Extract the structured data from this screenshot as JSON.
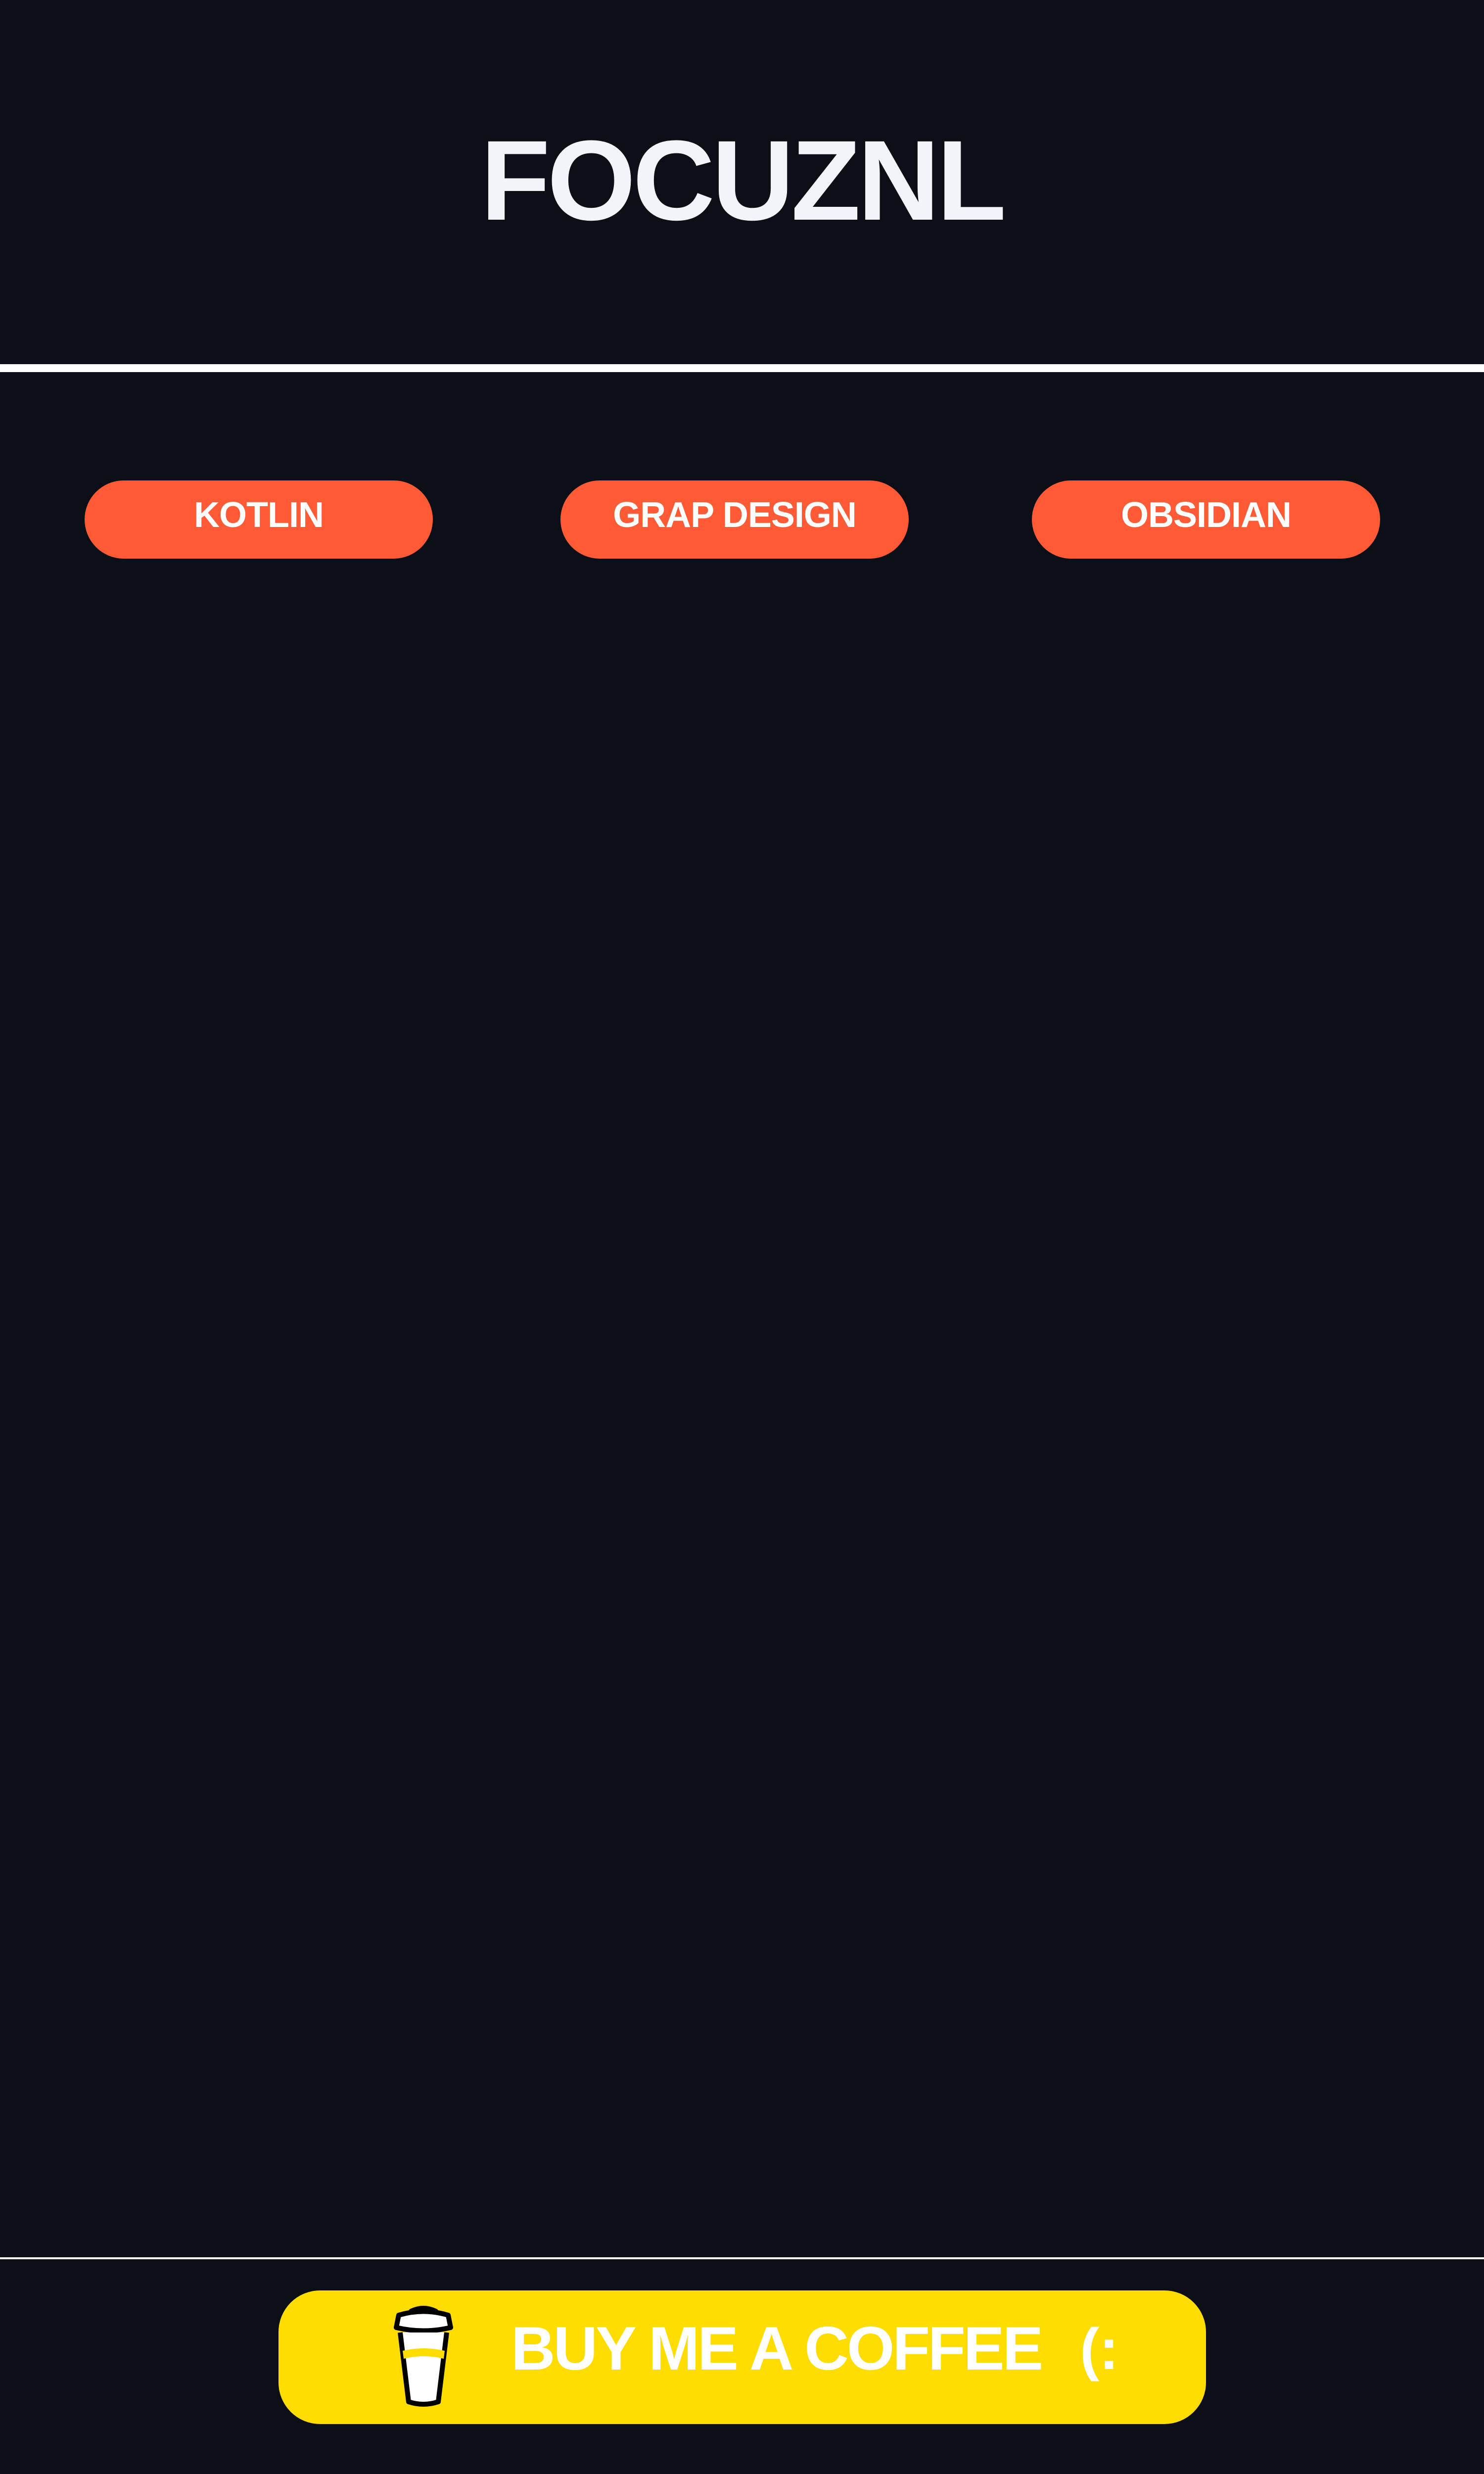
{
  "header": {
    "title": "FOCUZNL"
  },
  "tags": [
    {
      "label": "KOTLIN"
    },
    {
      "label": "GRAP DESIGN"
    },
    {
      "label": "OBSIDIAN"
    }
  ],
  "footer": {
    "coffee_label": "BUY ME A COFFEE",
    "smiley": "(:",
    "icon": "coffee-cup-icon"
  },
  "colors": {
    "background": "#0d0f16",
    "accent": "#ff5a36",
    "coffee_button": "#ffdd00",
    "text": "#ffffff"
  }
}
